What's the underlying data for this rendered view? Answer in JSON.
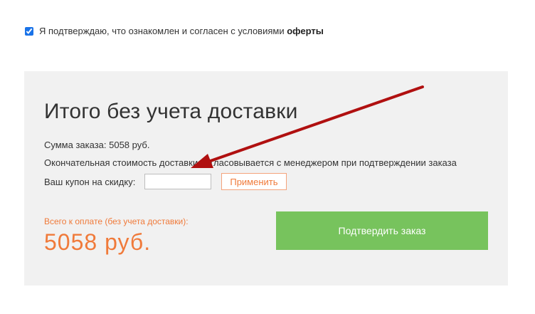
{
  "agreement": {
    "checked": true,
    "text": "Я подтверждаю, что ознакомлен и согласен с условиями ",
    "link_text": "оферты"
  },
  "summary": {
    "title": "Итого без учета доставки",
    "order_sum": "Сумма заказа: 5058 руб.",
    "delivery_note": "Окончательная стоимость доставки согласовывается с менеджером при подтверждении заказа",
    "coupon_label": "Ваш купон на скидку:",
    "coupon_value": "",
    "apply_label": "Применить",
    "total_label": "Всего к оплате (без учета доставки):",
    "total_value": "5058 руб.",
    "confirm_label": "Подтвердить заказ"
  },
  "colors": {
    "accent_orange": "#f07a3a",
    "confirm_green": "#77c35d",
    "panel_bg": "#f1f1f1",
    "annotation_arrow": "#b01010"
  }
}
